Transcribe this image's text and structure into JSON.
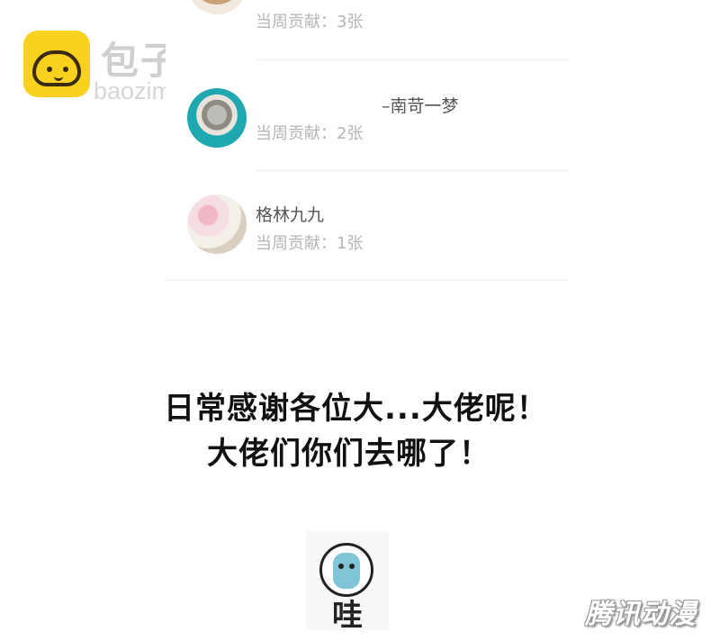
{
  "watermark": {
    "title": "包子漫畫",
    "url": "baozimh.com",
    "corner_text": "腾讯动漫"
  },
  "contributors": [
    {
      "name": "",
      "contribution": "当周贡献：3张",
      "avatar": "girl-avatar"
    },
    {
      "name": "–南苛一梦",
      "contribution": "当周贡献：2张",
      "avatar": "kitten-avatar"
    },
    {
      "name": "格林九九",
      "contribution": "当周贡献：1张",
      "avatar": "blossom-avatar"
    }
  ],
  "message": {
    "line1": "日常感谢各位大...大佬呢！",
    "line2": "大佬们你们去哪了！"
  },
  "sticker": {
    "label": "哇"
  },
  "colors": {
    "accent_teal": "#1fa8b0",
    "watermark_yellow": "#f8d21e"
  }
}
